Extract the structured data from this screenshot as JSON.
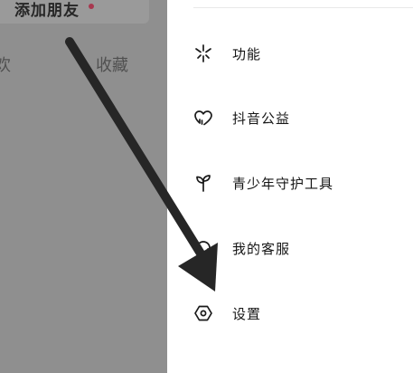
{
  "background_page": {
    "add_friend_label": "添加朋友",
    "tabs": [
      {
        "label": "欢"
      },
      {
        "label": "收藏"
      }
    ]
  },
  "drawer": {
    "menu": [
      {
        "label": "功能",
        "icon": "sparkle-icon"
      },
      {
        "label": "抖音公益",
        "icon": "heart-charity-icon"
      },
      {
        "label": "青少年守护工具",
        "icon": "sprout-icon"
      },
      {
        "label": "我的客服",
        "icon": "headset-icon"
      },
      {
        "label": "设置",
        "icon": "settings-hexagon-icon"
      }
    ]
  },
  "colors": {
    "overlay_dim": "#8f8f8f",
    "notification_dot": "#a8384f",
    "text_primary": "#161616",
    "arrow": "#262626"
  }
}
